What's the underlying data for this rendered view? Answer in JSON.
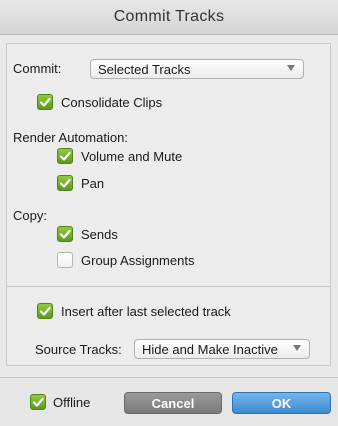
{
  "window": {
    "title": "Commit Tracks"
  },
  "commit": {
    "label": "Commit:",
    "value": "Selected Tracks"
  },
  "consolidate_clips": {
    "label": "Consolidate Clips",
    "checked": true
  },
  "render_automation": {
    "heading": "Render Automation:",
    "items": [
      {
        "label": "Volume and Mute",
        "checked": true
      },
      {
        "label": "Pan",
        "checked": true
      }
    ]
  },
  "copy": {
    "heading": "Copy:",
    "items": [
      {
        "label": "Sends",
        "checked": true
      },
      {
        "label": "Group Assignments",
        "checked": false
      }
    ]
  },
  "insert_after": {
    "label": "Insert after last selected track",
    "checked": true
  },
  "source_tracks": {
    "label": "Source Tracks:",
    "value": "Hide and Make Inactive"
  },
  "footer": {
    "offline_label": "Offline",
    "offline_checked": true,
    "cancel_label": "Cancel",
    "ok_label": "OK"
  },
  "colors": {
    "check_green": "#6aad27",
    "ok_blue": "#3d89cf",
    "cancel_gray": "#8a8a8a"
  },
  "icons": {
    "check": "checkmark-icon",
    "dropdown": "chevron-down-icon"
  }
}
